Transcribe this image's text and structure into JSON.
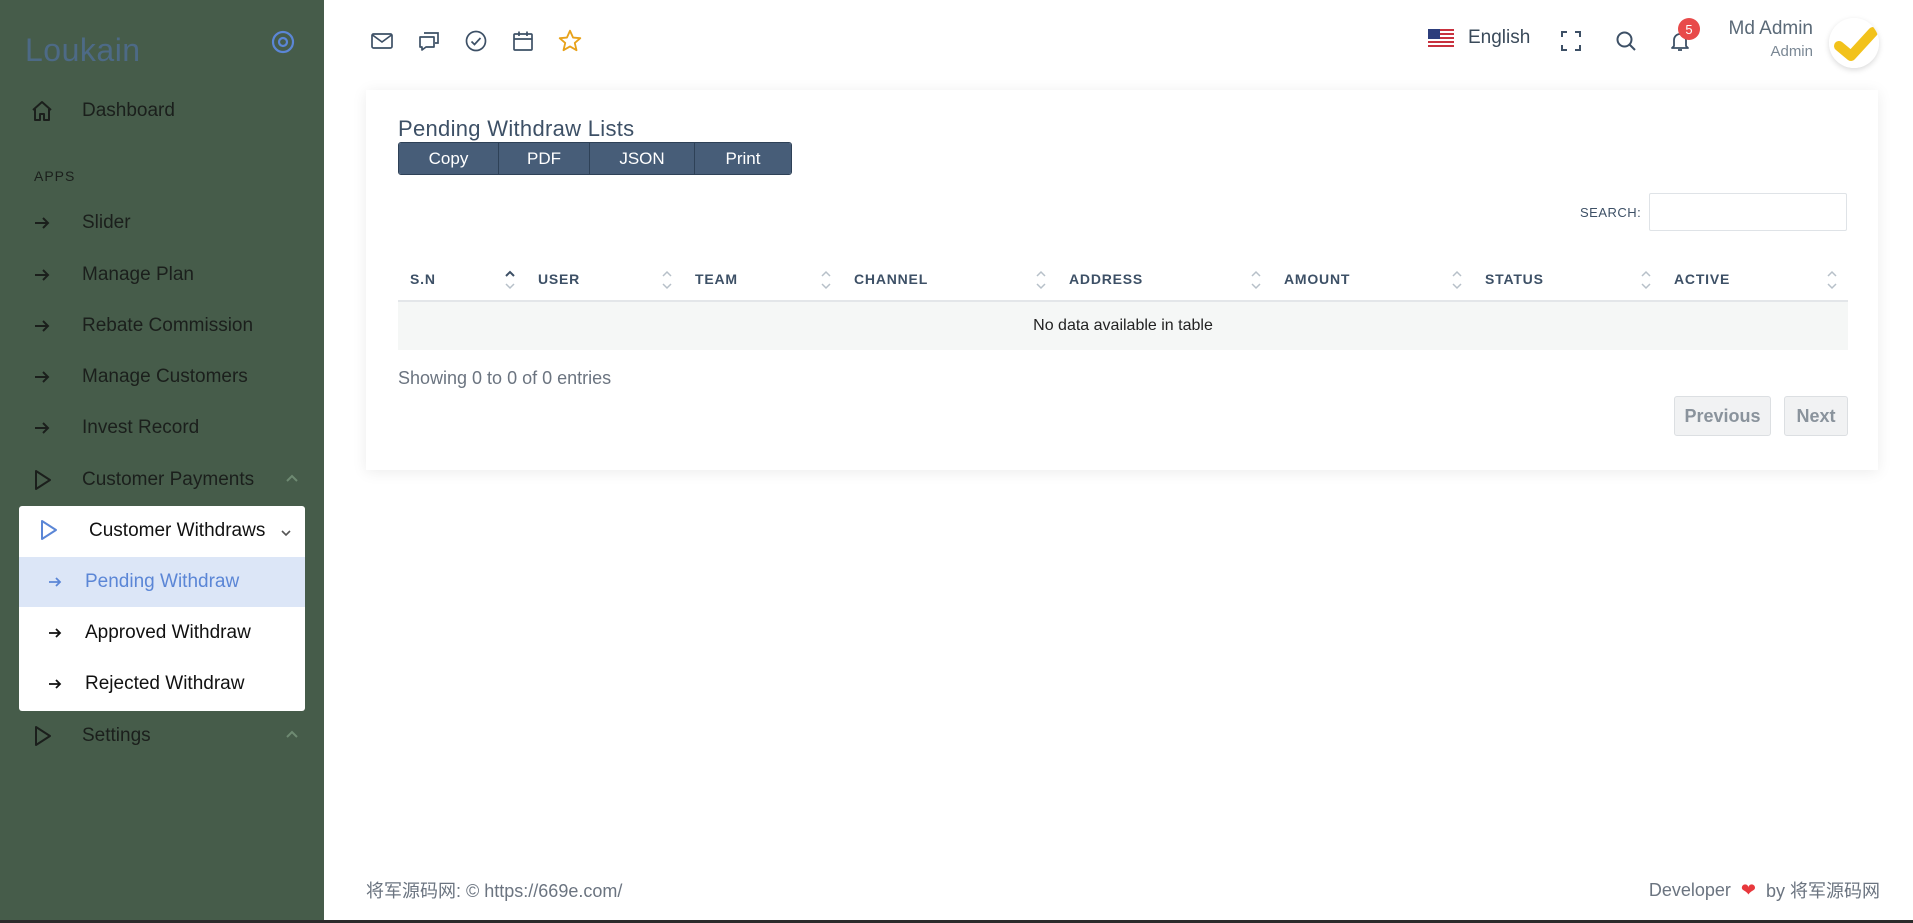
{
  "brand": {
    "name": "Loukain"
  },
  "sidebar": {
    "dashboard": "Dashboard",
    "section_apps": "APPS",
    "items": [
      {
        "label": "Slider"
      },
      {
        "label": "Manage Plan"
      },
      {
        "label": "Rebate Commission"
      },
      {
        "label": "Manage Customers"
      },
      {
        "label": "Invest Record"
      },
      {
        "label": "Customer Payments"
      }
    ],
    "withdraws": {
      "label": "Customer Withdraws",
      "children": [
        {
          "label": "Pending Withdraw",
          "active": true
        },
        {
          "label": "Approved Withdraw"
        },
        {
          "label": "Rejected Withdraw"
        }
      ]
    },
    "settings": "Settings"
  },
  "topbar": {
    "icons": [
      "mail-icon",
      "chat-icon",
      "check-circle-icon",
      "calendar-icon",
      "star-icon"
    ],
    "language": "English",
    "notification_count": "5",
    "user": {
      "name": "Md Admin",
      "role": "Admin"
    }
  },
  "card": {
    "title": "Pending Withdraw Lists",
    "buttons": [
      "Copy",
      "PDF",
      "JSON",
      "Print"
    ],
    "search_label": "SEARCH:",
    "search_value": "",
    "columns": [
      "S.N",
      "USER",
      "TEAM",
      "CHANNEL",
      "ADDRESS",
      "AMOUNT",
      "STATUS",
      "ACTIVE"
    ],
    "empty_message": "No data available in table",
    "info": "Showing 0 to 0 of 0 entries",
    "prev": "Previous",
    "next": "Next"
  },
  "footer": {
    "left": "将军源码网: © https://669e.com/",
    "right_prefix": "Developer",
    "right_suffix": "by 将军源码网"
  },
  "colors": {
    "sidebar_bg": "#465c4a",
    "button_bg": "#475d78",
    "active_sub_bg": "#dce6f7",
    "active_sub_text": "#5b86d6",
    "badge": "#e84a4a",
    "star": "#e8a21a"
  }
}
